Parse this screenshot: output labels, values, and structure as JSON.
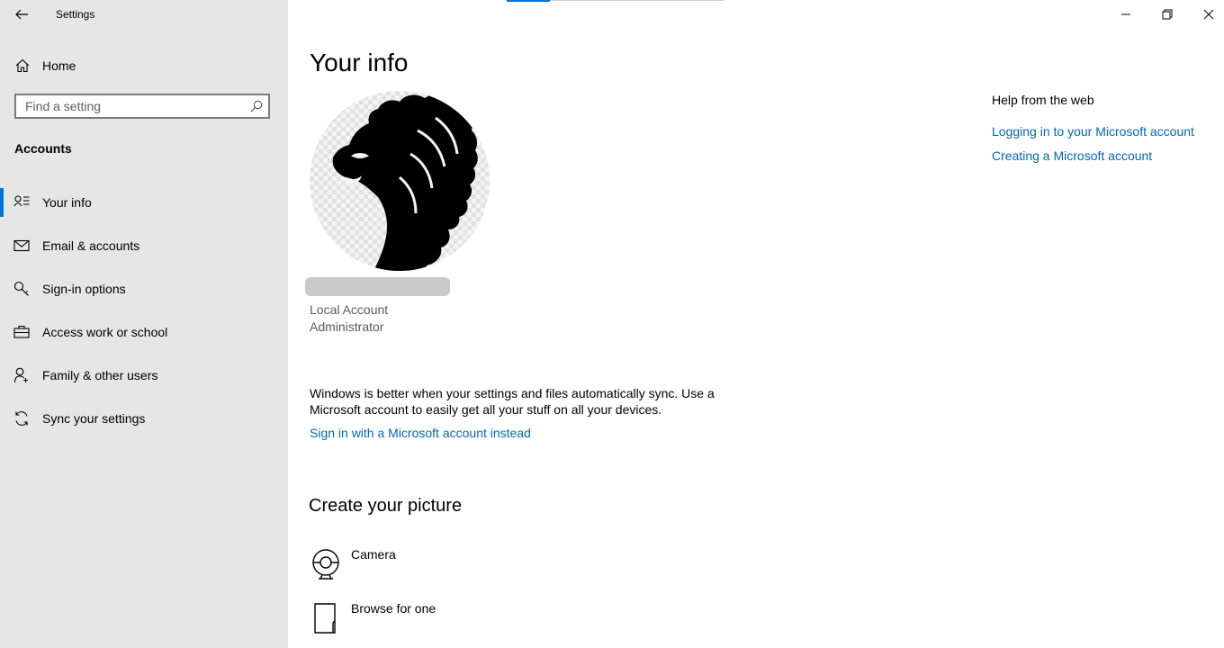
{
  "window": {
    "title": "Settings",
    "controls": {
      "minimize": "minimize",
      "restore": "restore",
      "close": "close"
    }
  },
  "sidebar": {
    "home_label": "Home",
    "search": {
      "placeholder": "Find a setting",
      "value": ""
    },
    "section": "Accounts",
    "items": [
      {
        "label": "Your info",
        "icon": "user-info-icon",
        "active": true
      },
      {
        "label": "Email & accounts",
        "icon": "mail-icon",
        "active": false
      },
      {
        "label": "Sign-in options",
        "icon": "key-icon",
        "active": false
      },
      {
        "label": "Access work or school",
        "icon": "briefcase-icon",
        "active": false
      },
      {
        "label": "Family & other users",
        "icon": "person-add-icon",
        "active": false
      },
      {
        "label": "Sync your settings",
        "icon": "sync-icon",
        "active": false
      }
    ],
    "accent_color": "#0078d7"
  },
  "main": {
    "title": "Your info",
    "account_type": "Local Account",
    "account_role": "Administrator",
    "sync_text": "Windows is better when your settings and files automatically sync. Use a Microsoft account to easily get all your stuff on all your devices.",
    "signin_link": "Sign in with a Microsoft account instead",
    "create_picture": {
      "title": "Create your picture",
      "options": [
        {
          "label": "Camera",
          "icon": "camera-icon"
        },
        {
          "label": "Browse for one",
          "icon": "browse-file-icon"
        }
      ]
    }
  },
  "help": {
    "title": "Help from the web",
    "links": [
      "Logging in to your Microsoft account",
      "Creating a Microsoft account"
    ]
  },
  "colors": {
    "link": "#0067b8",
    "sidebar_bg": "#e6e6e6"
  }
}
